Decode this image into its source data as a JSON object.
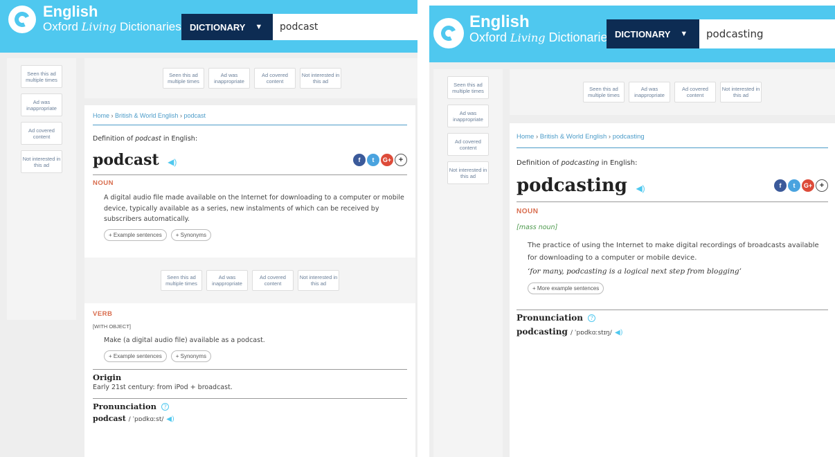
{
  "brand": {
    "line1": "English",
    "line2_prefix": "Oxford",
    "line2_italic": "Living",
    "line2_suffix": "Dictionaries"
  },
  "ads": {
    "seen": "Seen this ad multiple times",
    "inappropriate": "Ad was inappropriate",
    "covered": "Ad covered content",
    "not_interested": "Not interested in this ad"
  },
  "left": {
    "dictionary_label": "DICTIONARY",
    "search_value": "podcast",
    "breadcrumb": [
      "Home",
      "British & World English",
      "podcast"
    ],
    "def_prefix": "Definition of",
    "def_word": "podcast",
    "def_suffix": "in English:",
    "headword": "podcast",
    "noun": {
      "pos": "NOUN",
      "definition": "A digital audio file made available on the Internet for downloading to a computer or mobile device, typically available as a series, new instalments of which can be received by subscribers automatically.",
      "pill1": "+ Example sentences",
      "pill2": "+ Synonyms"
    },
    "verb": {
      "pos": "VERB",
      "grammar": "[WITH OBJECT]",
      "definition": "Make (a digital audio file) available as a podcast.",
      "pill1": "+ Example sentences",
      "pill2": "+ Synonyms"
    },
    "origin": {
      "heading": "Origin",
      "text": "Early 21st century: from iPod + broadcast."
    },
    "pronunciation": {
      "heading": "Pronunciation",
      "word": "podcast",
      "ipa": "/ ˈpɒdkɑːst/"
    }
  },
  "right": {
    "dictionary_label": "DICTIONARY",
    "search_value": "podcasting",
    "breadcrumb": [
      "Home",
      "British & World English",
      "podcasting"
    ],
    "def_prefix": "Definition of",
    "def_word": "podcasting",
    "def_suffix": "in English:",
    "headword": "podcasting",
    "noun": {
      "pos": "NOUN",
      "label": "[mass noun]",
      "definition": "The practice of using the Internet to make digital recordings of broadcasts available for downloading to a computer or mobile device.",
      "example": "‘for many, podcasting is a logical next step from blogging’",
      "pill": "+ More example sentences"
    },
    "pronunciation": {
      "heading": "Pronunciation",
      "word": "podcasting",
      "ipa": "/ ˈpɒdkɑːstɪŋ/"
    }
  },
  "icons": {
    "facebook": "f",
    "twitter": "t",
    "google": "G+",
    "more": "+",
    "help": "?",
    "speaker": "◀)"
  },
  "colors": {
    "header": "#4fc8ef",
    "dictionary_button": "#0d2c53",
    "pos": "#d86b4c",
    "link": "#4b9bc8"
  }
}
